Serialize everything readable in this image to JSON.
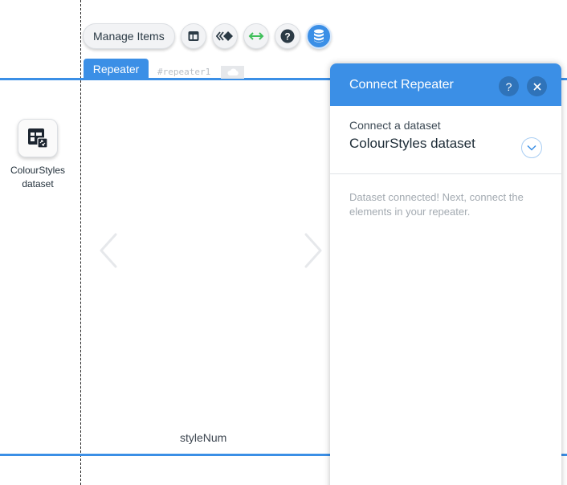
{
  "toolbar": {
    "manage_items_label": "Manage Items",
    "tools": [
      "layout-icon",
      "animation-icon",
      "stretch-icon",
      "help-icon",
      "database-icon"
    ]
  },
  "repeater": {
    "tag_label": "Repeater",
    "element_id": "#repeater1"
  },
  "canvas": {
    "dataset_label": "ColourStyles dataset",
    "field_label": "styleNum"
  },
  "panel": {
    "title": "Connect Repeater",
    "help_label": "?",
    "connect_label": "Connect a dataset",
    "selected_dataset": "ColourStyles dataset",
    "message": "Dataset connected! Next, connect the elements in your repeater."
  },
  "colors": {
    "accent": "#3b8fe6",
    "stretch_green": "#3fbf5a",
    "dark_icon": "#2b3a45"
  }
}
